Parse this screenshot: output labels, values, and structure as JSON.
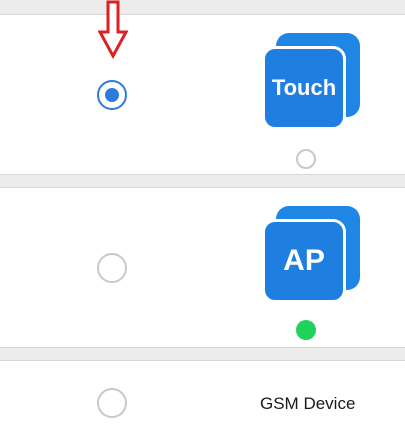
{
  "devices": [
    {
      "icon_label": "Touch",
      "selected": true,
      "online": false,
      "icon_color": "#1f7fe0"
    },
    {
      "icon_label": "AP",
      "selected": false,
      "online": true,
      "icon_color": "#1f7fe0",
      "status_color": "#1fd25a"
    },
    {
      "label": "GSM Device",
      "selected": false
    }
  ],
  "annotation": {
    "arrow_color": "#e02020",
    "arrow_icon": "down-arrow-icon"
  },
  "accent_color": "#2d7be0"
}
